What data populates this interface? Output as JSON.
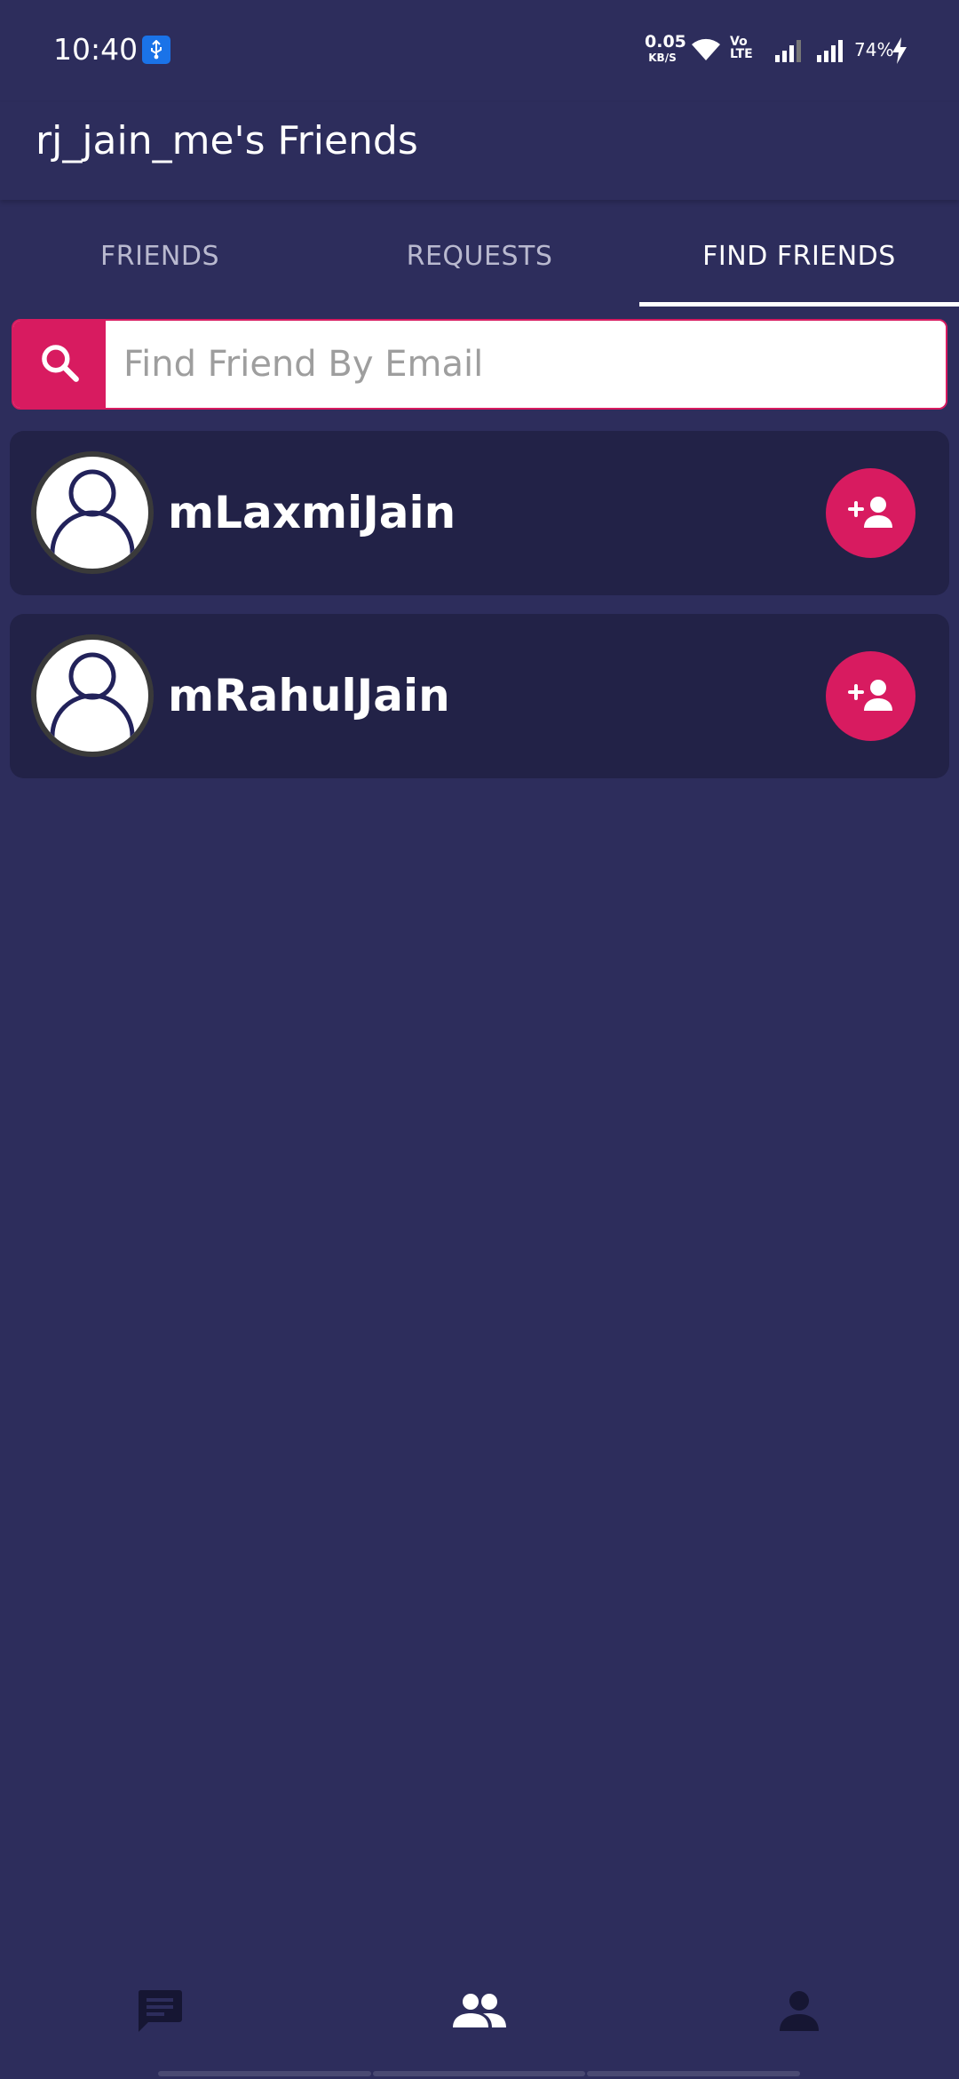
{
  "status_bar": {
    "time": "10:40",
    "net_speed_value": "0.05",
    "net_speed_unit": "KB/S",
    "volte": "Vo\nLTE",
    "battery": "74%"
  },
  "app_bar": {
    "title": "rj_jain_me's Friends"
  },
  "tabs": [
    {
      "label": "FRIENDS",
      "active": false
    },
    {
      "label": "REQUESTS",
      "active": false
    },
    {
      "label": "FIND FRIENDS",
      "active": true
    }
  ],
  "search": {
    "placeholder": "Find Friend By Email",
    "value": ""
  },
  "users": [
    {
      "name": "mLaxmiJain",
      "action_icon": "add-person-icon"
    },
    {
      "name": "mRahulJain",
      "action_icon": "add-person-icon"
    }
  ],
  "bottom_nav": [
    {
      "icon": "chat-icon",
      "active": false
    },
    {
      "icon": "group-icon",
      "active": true
    },
    {
      "icon": "person-icon",
      "active": false
    }
  ],
  "colors": {
    "background": "#2d2d5c",
    "card": "#222247",
    "accent": "#d81b60",
    "nav_inactive": "#161633",
    "nav_active": "#ffffff"
  }
}
